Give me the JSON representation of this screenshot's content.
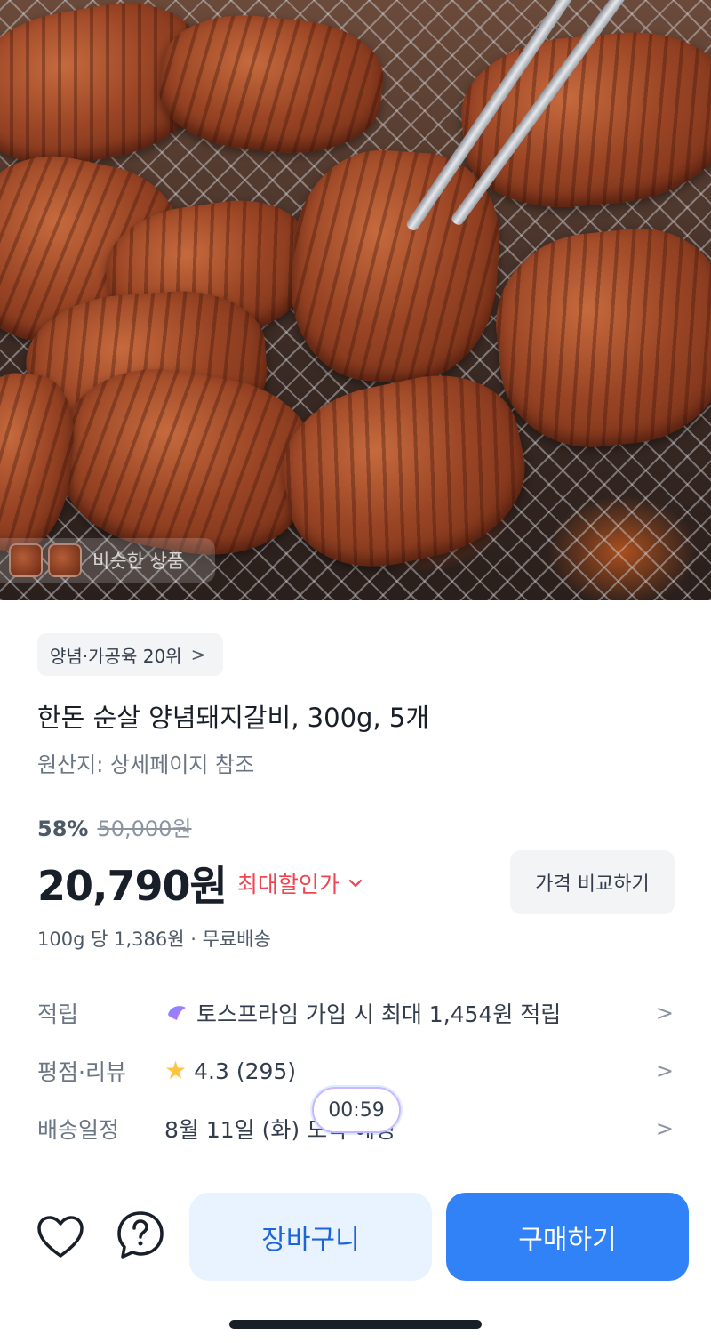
{
  "hero": {
    "similar_products_label": "비슷한 상품"
  },
  "category": {
    "label": "양념·가공육 20위",
    "chevron": ">"
  },
  "product": {
    "title": "한돈 순살 양념돼지갈비, 300g, 5개",
    "origin": "원산지: 상세페이지 참조"
  },
  "pricing": {
    "discount_rate": "58%",
    "original_price": "50,000원",
    "sale_price": "20,790원",
    "max_discount_label": "최대할인가",
    "compare_button": "가격 비교하기",
    "unit_line": "100g 당 1,386원 · 무료배송"
  },
  "info": {
    "points_label": "적립",
    "points_value": "토스프라임 가입 시 최대 1,454원 적립",
    "rating_label": "평점·리뷰",
    "rating_value": "4.3 (295)",
    "delivery_label": "배송일정",
    "delivery_value": "8월 11일 (화) 도착 예정",
    "chevron": ">"
  },
  "timer": "00:59",
  "actions": {
    "cart_button": "장바구니",
    "buy_button": "구매하기"
  },
  "colors": {
    "accent_blue": "#3182f6",
    "discount_red": "#f04452",
    "star_yellow": "#ffc342"
  },
  "icons": [
    "heart-icon",
    "question-chat-icon",
    "star-icon",
    "toss-prime-icon",
    "chevron-right-icon"
  ]
}
